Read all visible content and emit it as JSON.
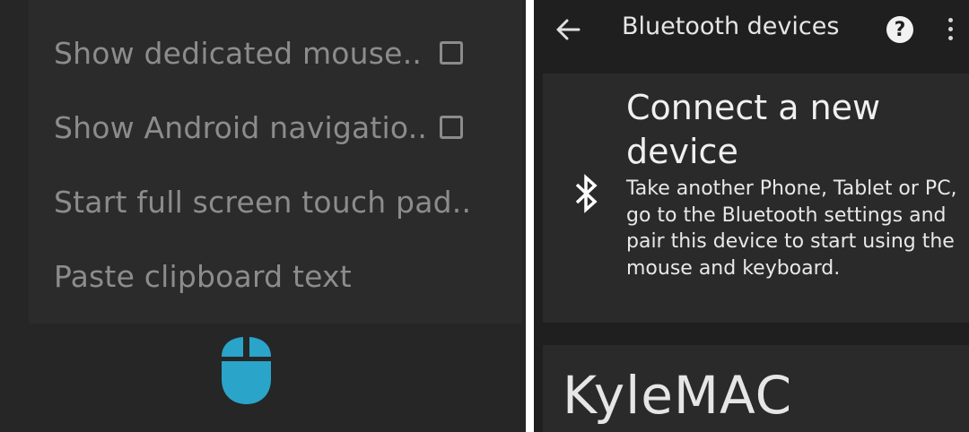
{
  "left_menu": {
    "items": [
      {
        "label": "Show dedicated mouse..",
        "has_checkbox": true,
        "checked": false
      },
      {
        "label": "Show Android navigatio..",
        "has_checkbox": true,
        "checked": false
      },
      {
        "label": "Start full screen touch pad..",
        "has_checkbox": false
      },
      {
        "label": "Paste clipboard text",
        "has_checkbox": false
      }
    ]
  },
  "mouse_icon": {
    "name": "mouse-icon",
    "color": "#2aa4c9"
  },
  "appbar": {
    "title": "Bluetooth devices",
    "back_icon": "back-arrow-icon",
    "help_icon": "help-icon",
    "help_glyph": "?",
    "more_icon": "more-vert-icon"
  },
  "connect_card": {
    "title": "Connect a new device",
    "description": "Take another Phone, Tablet or PC, go to the Bluetooth settings and pair this device to start using the mouse and keyboard.",
    "icon": "bluetooth-icon"
  },
  "device_card": {
    "name": "KyleMAC"
  },
  "colors": {
    "left_background": "#262626",
    "right_background": "#1f1f1f",
    "card": "#2a2a2a",
    "accent": "#2aa4c9",
    "muted_text": "#8c8c8c"
  }
}
